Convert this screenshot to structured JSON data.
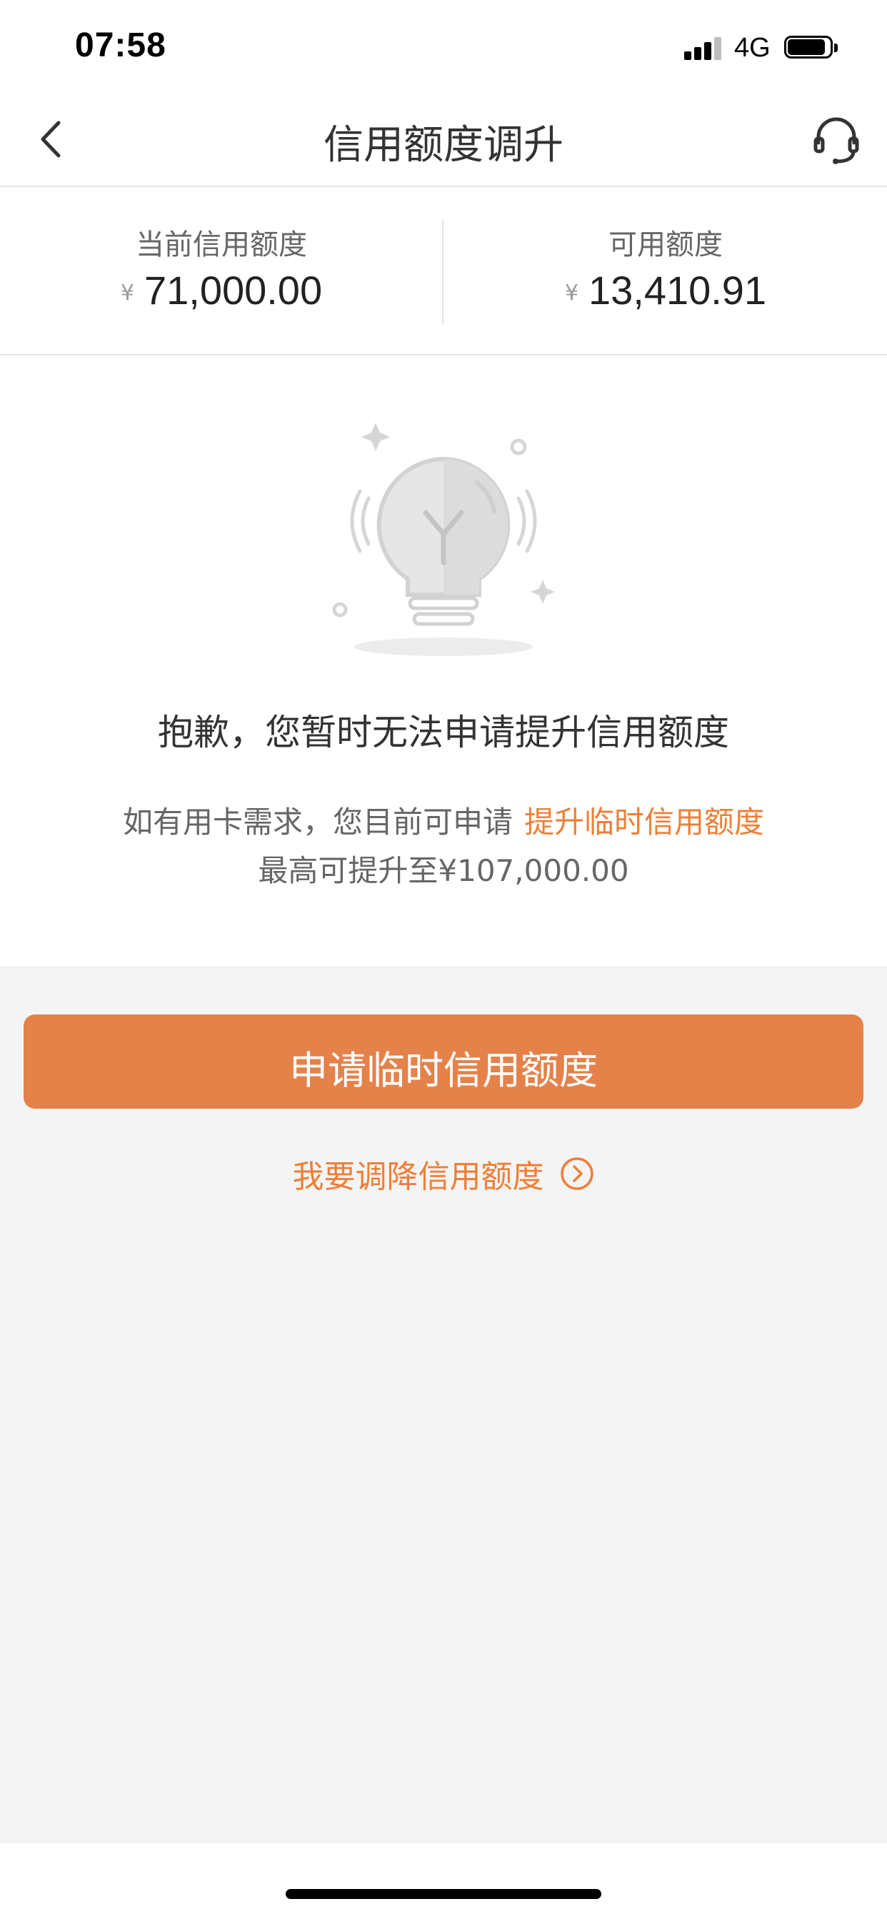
{
  "status_bar": {
    "time": "07:58",
    "network": "4G",
    "icons": [
      "signal-icon",
      "battery-icon"
    ]
  },
  "nav": {
    "title": "信用额度调升",
    "back_icon": "chevron-left-icon",
    "service_icon": "customer-service-headset-icon"
  },
  "credit": {
    "currency_symbol": "¥",
    "current_label": "当前信用额度",
    "current_value": "71,000.00",
    "available_label": "可用额度",
    "available_value": "13,410.91"
  },
  "notice": {
    "illustration_icon": "lightbulb-icon",
    "sorry_text": "抱歉，您暂时无法申请提升信用额度",
    "hint_prefix": "如有用卡需求，您目前可申请",
    "hint_link": "提升临时信用额度",
    "hint_max": "最高可提升至¥107,000.00"
  },
  "actions": {
    "apply_temp_label": "申请临时信用额度",
    "lower_limit_label": "我要调降信用额度",
    "lower_limit_icon": "circle-chevron-right-icon"
  },
  "colors": {
    "accent": "#ee7f38",
    "button": "#e4824a",
    "background": "#f4f4f4"
  }
}
